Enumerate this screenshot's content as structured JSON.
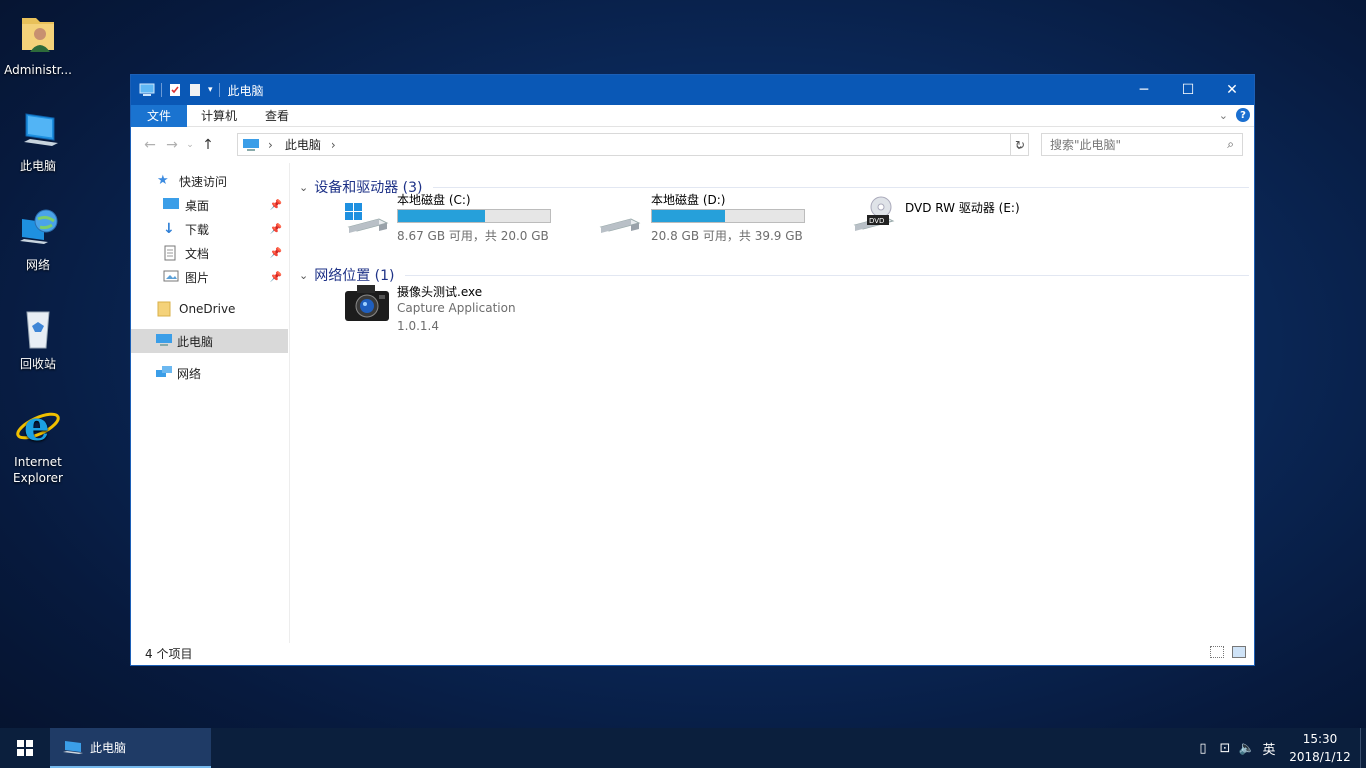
{
  "desktop": {
    "icons": [
      {
        "label": "Administr..."
      },
      {
        "label": "此电脑"
      },
      {
        "label": "网络"
      },
      {
        "label": "回收站"
      },
      {
        "label_line1": "Internet",
        "label_line2": "Explorer"
      }
    ]
  },
  "window": {
    "title": "此电脑",
    "controls": {
      "minimize": "─",
      "maximize": "☐",
      "close": "✕"
    },
    "ribbon_tabs": [
      "文件",
      "计算机",
      "查看"
    ],
    "address": {
      "crumb": "此电脑",
      "sep_left": "›",
      "sep_right": "›"
    },
    "search_placeholder": "搜索\"此电脑\"",
    "nav": {
      "quick_access": "快速访问",
      "desktop": "桌面",
      "downloads": "下载",
      "documents": "文档",
      "pictures": "图片",
      "onedrive": "OneDrive",
      "this_pc": "此电脑",
      "network": "网络"
    },
    "groups": {
      "devices": "设备和驱动器 (3)",
      "network": "网络位置 (1)"
    },
    "drives": [
      {
        "name": "本地磁盘 (C:)",
        "free_text": "8.67 GB 可用，共 20.0 GB",
        "used_fraction": 0.57
      },
      {
        "name": "本地磁盘 (D:)",
        "free_text": "20.8 GB 可用，共 39.9 GB",
        "used_fraction": 0.48
      },
      {
        "name": "DVD RW 驱动器 (E:)"
      }
    ],
    "network_item": {
      "name": "摄像头测试.exe",
      "description": "Capture Application",
      "version": "1.0.1.4"
    },
    "status": "4 个项目"
  },
  "taskbar": {
    "active_item": "此电脑",
    "tray_lang": "英",
    "time": "15:30",
    "date": "2018/1/12"
  }
}
